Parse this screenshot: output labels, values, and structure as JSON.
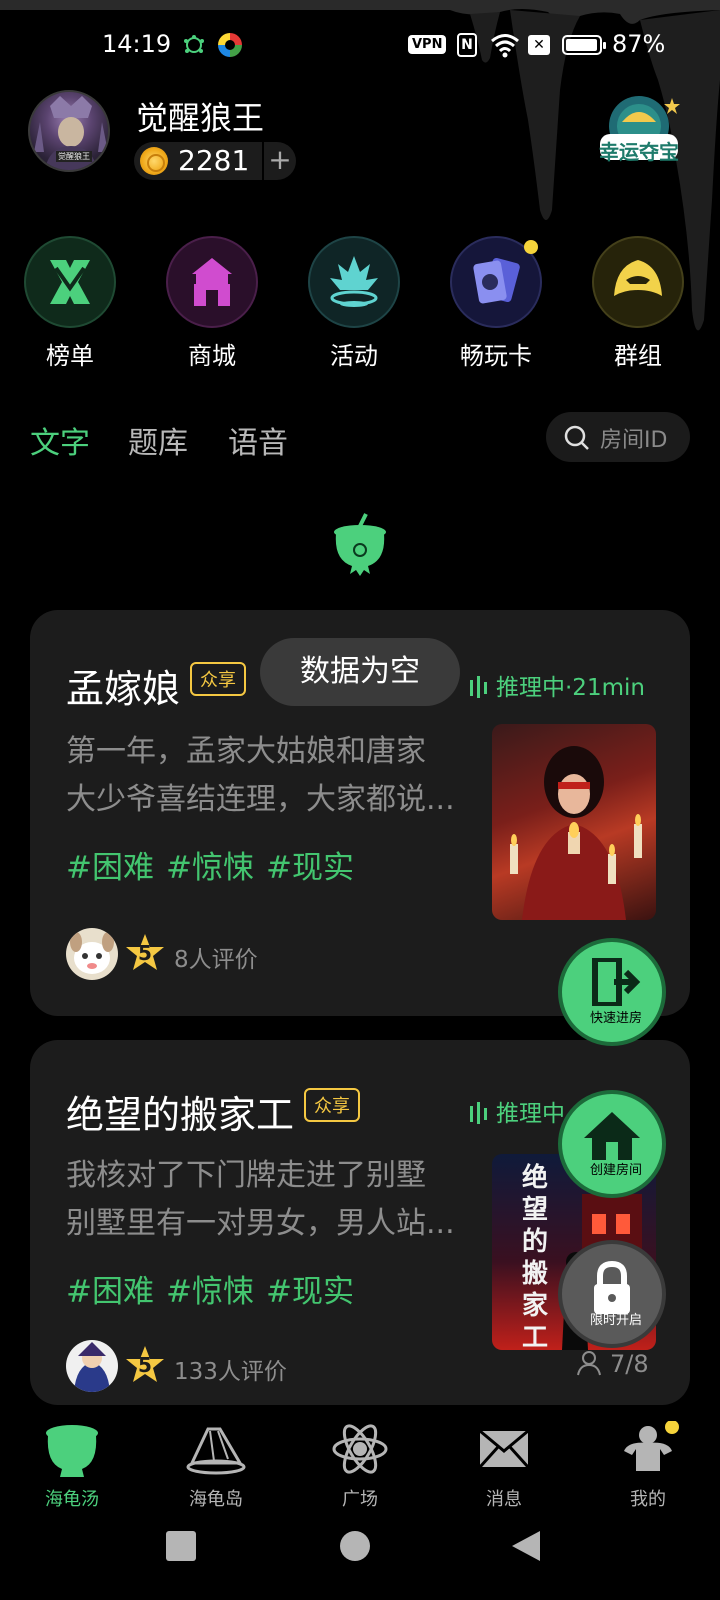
{
  "status": {
    "time": "14:19",
    "vpn": "VPN",
    "battery_pct": "87%",
    "battery_level": 0.87
  },
  "user": {
    "name": "觉醒狼王",
    "coins": "2281",
    "add": "+",
    "avatar_tag": "觉醒狼王"
  },
  "lucky": {
    "label": "幸运夺宝"
  },
  "quick": [
    {
      "label": "榜单"
    },
    {
      "label": "商城"
    },
    {
      "label": "活动"
    },
    {
      "label": "畅玩卡"
    },
    {
      "label": "群组"
    }
  ],
  "tabs": [
    {
      "label": "文字"
    },
    {
      "label": "题库"
    },
    {
      "label": "语音"
    }
  ],
  "search": {
    "placeholder": "房间ID"
  },
  "cards": [
    {
      "title": "孟嫁娘",
      "badge": "众享",
      "state": "推理中·21min",
      "desc": [
        "第一年，孟家大姑娘和唐家",
        "大少爷喜结连理，大家都说..."
      ],
      "tags": [
        "#困难",
        "#惊悚",
        "#现实"
      ],
      "rating": "5",
      "reviews": "8人评价"
    },
    {
      "title": "绝望的搬家工",
      "badge": "众享",
      "state": "推理中",
      "desc": [
        "我核对了下门牌走进了别墅",
        "别墅里有一对男女，男人站..."
      ],
      "tags": [
        "#困难",
        "#惊悚",
        "#现实"
      ],
      "rating": "5",
      "reviews": "133人评价",
      "players": "7/8",
      "cover_text": [
        "绝",
        "望",
        "的",
        "搬",
        "家",
        "工"
      ]
    }
  ],
  "toast": "数据为空",
  "fabs": [
    {
      "label": "快速进房"
    },
    {
      "label": "创建房间"
    },
    {
      "label": "限时开启"
    }
  ],
  "nav": [
    {
      "label": "海龟汤",
      "active": true
    },
    {
      "label": "海龟岛"
    },
    {
      "label": "广场"
    },
    {
      "label": "消息"
    },
    {
      "label": "我的"
    }
  ],
  "colors": {
    "accent": "#4cd07d",
    "badge": "#f5c842",
    "card_bg": "#1c1c1c"
  }
}
